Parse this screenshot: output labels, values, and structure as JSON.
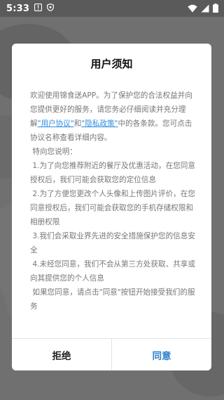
{
  "status_bar": {
    "time": "5:33"
  },
  "dialog": {
    "title": "用户须知",
    "intro_prefix": "欢迎使用锦食送APP。为了保护您的合法权益并向您提供更好的服务，请您务必仔细阅读并充分理解",
    "user_agreement_link": "\"用户协议\"",
    "and_text": "和",
    "privacy_policy_link": "\"隐私政策\"",
    "intro_suffix": "中的各条款。您可点击协议名称查看详细内容。",
    "notice_heading": "特向您说明：",
    "items": [
      "1.为了向您推荐附近的餐厅及优惠活动，在您同意授权后，我们可能会获取您的定位信息",
      "2.为了方便您更改个人头像和上传图片评价，在您同意授权后，我们可能会获取您的手机存储权限和相册权限",
      "3.我们会采取业界先进的安全措施保护您的信息安全",
      "4.未经您同意，我们不会从第三方处获取、共享或向其提供您的个人信息"
    ],
    "closing": "如果您同意，请点击\"同意\"按钮开始接受我们的服务",
    "refuse_label": "拒绝",
    "agree_label": "同意"
  }
}
